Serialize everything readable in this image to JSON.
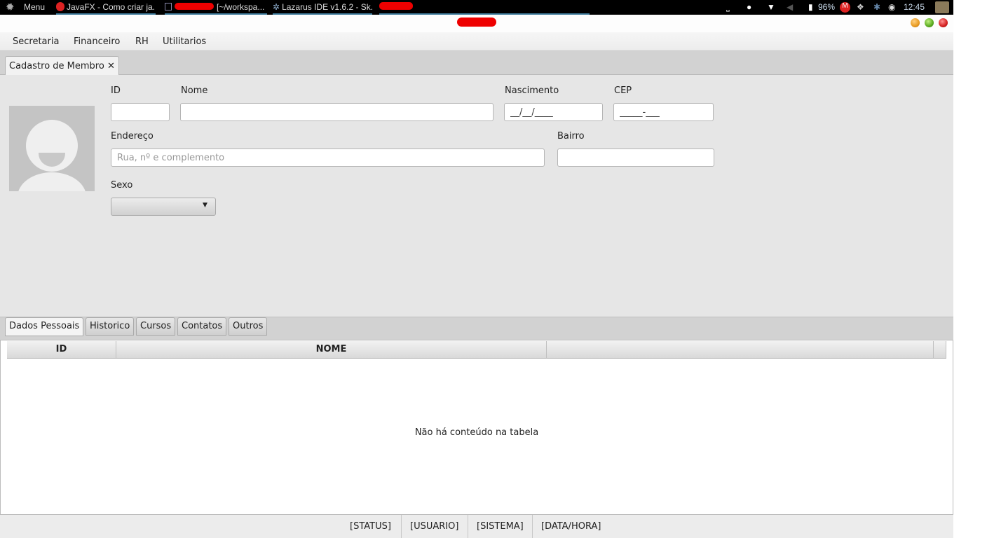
{
  "system_bar": {
    "menu_label": "Menu",
    "tasks": [
      "JavaFX - Como criar ja...",
      "[~/workspa...",
      "Lazarus IDE v1.6.2 - Sk..."
    ],
    "battery": "96%",
    "clock": "12:45"
  },
  "menubar": {
    "items": [
      "Secretaria",
      "Financeiro",
      "RH",
      "Utilitarios"
    ]
  },
  "main_tab": {
    "label": "Cadastro de Membro",
    "close": "✕"
  },
  "form": {
    "id_label": "ID",
    "nome_label": "Nome",
    "nascimento_label": "Nascimento",
    "nascimento_value": "__/__/____",
    "cep_label": "CEP",
    "cep_value": "_____-___",
    "endereco_label": "Endereço",
    "endereco_placeholder": "Rua, nº e complemento",
    "bairro_label": "Bairro",
    "sexo_label": "Sexo"
  },
  "sub_tabs": [
    "Dados Pessoais",
    "Historico",
    "Cursos",
    "Contatos",
    "Outros"
  ],
  "table": {
    "columns": [
      "ID",
      "NOME",
      ""
    ],
    "empty_message": "Não há conteúdo na tabela"
  },
  "statusbar": [
    "[STATUS]",
    "[USUARIO]",
    "[SISTEMA]",
    "[DATA/HORA]"
  ],
  "colors": {
    "win_min": "#e89a20",
    "win_max": "#5aaa20",
    "win_close": "#d42020"
  }
}
